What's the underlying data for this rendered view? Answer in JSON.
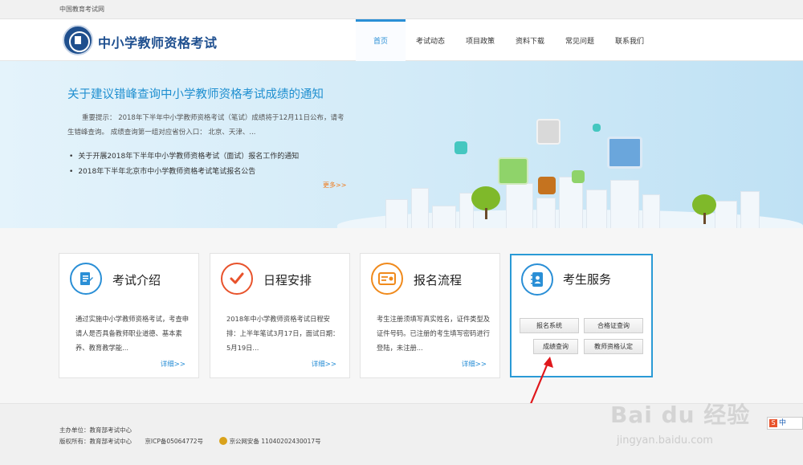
{
  "topbar": {
    "text": "中国教育考试网"
  },
  "header": {
    "site_title": "中小学教师资格考试",
    "nav": [
      "首页",
      "考试动态",
      "项目政策",
      "资料下载",
      "常见问题",
      "联系我们"
    ]
  },
  "banner": {
    "title": "关于建议错峰查询中小学教师资格考试成绩的通知",
    "text": "重要提示：  2018年下半年中小学教师资格考试（笔试）成绩将于12月11日公布，请考生错峰查询。 成绩查询第一组对应省份入口： 北京、天津、...",
    "news": [
      "关于开展2018年下半年中小学教师资格考试（面试）报名工作的通知",
      "2018年下半年北京市中小学教师资格考试笔试报名公告"
    ],
    "more": "更多>>"
  },
  "cards": [
    {
      "title": "考试介绍",
      "text": "通过实施中小学教师资格考试，考查申请人是否具备教师职业道德、基本素养、教育教学能...",
      "detail": "详细>>",
      "color": "#2a8fd6"
    },
    {
      "title": "日程安排",
      "text": "2018年中小学教师资格考试日程安排：上半年笔试3月17日，面试日期：5月19日...",
      "detail": "详细>>",
      "color": "#e8532c"
    },
    {
      "title": "报名流程",
      "text": "考生注册须填写真实姓名，证件类型及证件号码。已注册的考生填写密码进行登陆，未注册...",
      "detail": "详细>>",
      "color": "#f08a1c"
    }
  ],
  "service": {
    "title": "考生服务",
    "buttons": [
      "报名系统",
      "合格证查询",
      "成绩查询",
      "教师资格认定"
    ],
    "color": "#2a9ad6"
  },
  "footer": {
    "organizer": "主办单位：教育部考试中心",
    "copyright": "版权所有：教育部考试中心",
    "icp": "京ICP备05064772号",
    "police": "京公网安备 11040202430017号"
  },
  "watermark": {
    "main": "Bai du 经验",
    "sub": "jingyan.baidu.com"
  },
  "ime": {
    "label": "中"
  },
  "colors": {
    "accent": "#2a8fd6",
    "arrow": "#e0181c"
  }
}
